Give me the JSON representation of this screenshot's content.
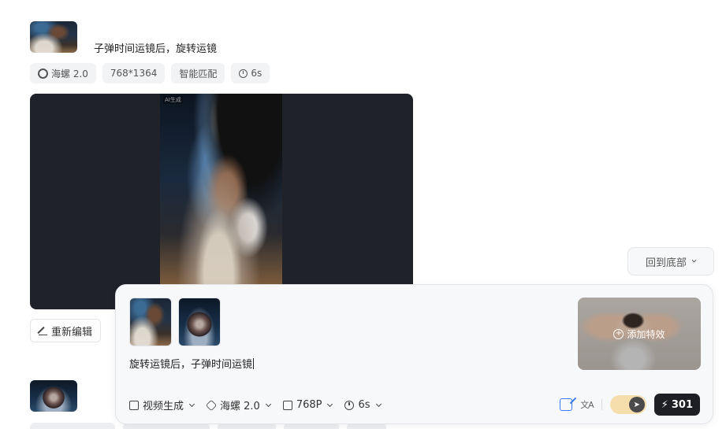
{
  "task": {
    "prompt": "子弹时间运镜后，旋转运镜",
    "tags": [
      {
        "icon": "model-logo-icon",
        "label": "海螺 2.0"
      },
      {
        "label": "768*1364"
      },
      {
        "label": "智能匹配"
      },
      {
        "icon": "clock-icon",
        "label": "6s"
      }
    ],
    "video_watermark": "AI生成",
    "actions": {
      "reedit_label": "重新编辑"
    }
  },
  "back_to_bottom_label": "回到底部",
  "composer": {
    "text": "旋转运镜后，子弹时间运镜",
    "effect_label": "添加特效",
    "toolbar": {
      "mode_label": "视频生成",
      "model_label": "海螺 2.0",
      "resolution_label": "768P",
      "duration_label": "6s"
    },
    "credits": "301"
  }
}
